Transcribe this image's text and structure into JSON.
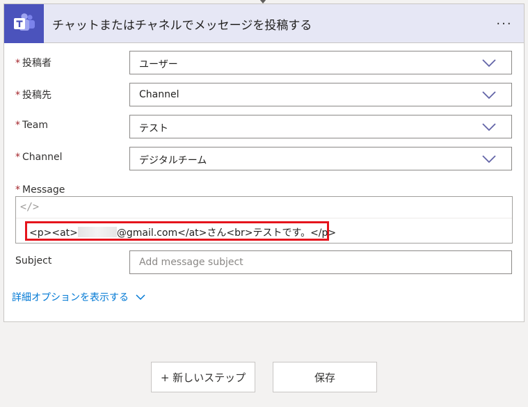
{
  "action_card": {
    "title": "チャットまたはチャネルでメッセージを投稿する",
    "more_label": "···"
  },
  "fields": {
    "poster": {
      "label": "投稿者",
      "value": "ユーザー"
    },
    "post_in": {
      "label": "投稿先",
      "value": "Channel"
    },
    "team": {
      "label": "Team",
      "value": "テスト"
    },
    "channel": {
      "label": "Channel",
      "value": "デジタルチーム"
    },
    "message": {
      "label": "Message",
      "code_icon": "</>",
      "before": "<p><at>",
      "after": "@gmail.com</at>さん<br>テストです。</p>"
    },
    "subject": {
      "label": "Subject",
      "placeholder": "Add message subject"
    }
  },
  "required_mark": "*",
  "advanced_options_label": "詳細オプションを表示する",
  "footer": {
    "new_step_label": "+ 新しいステップ",
    "save_label": "保存"
  },
  "colors": {
    "teams_brand": "#4b53bc",
    "header_bg": "#e6e7f5",
    "required": "#a4262c",
    "link": "#0078d4",
    "highlight": "#e5141c"
  }
}
